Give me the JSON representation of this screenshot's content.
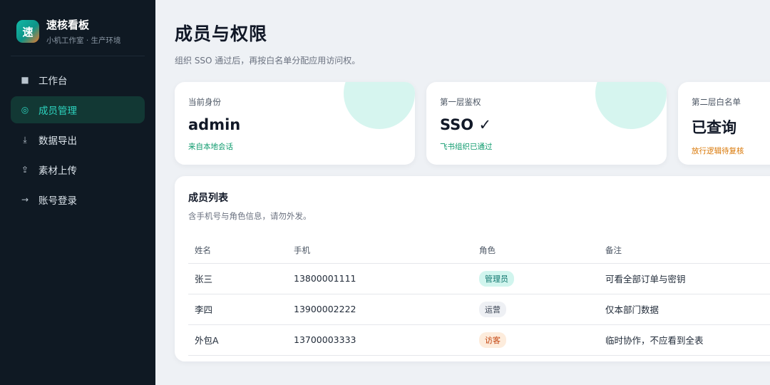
{
  "brand": {
    "logo": "速",
    "name": "速核看板",
    "subtitle": "小机工作室 · 生产环境"
  },
  "nav": [
    {
      "label": "工作台",
      "icon": "■",
      "active": false
    },
    {
      "label": "成员管理",
      "icon": "◎",
      "active": true
    },
    {
      "label": "数据导出",
      "icon": "⤓",
      "active": false
    },
    {
      "label": "素材上传",
      "icon": "⇪",
      "active": false
    },
    {
      "label": "账号登录",
      "icon": "→",
      "active": false
    }
  ],
  "page": {
    "title": "成员与权限",
    "subtitle": "组织 SSO 通过后，再按白名单分配应用访问权。"
  },
  "cards": [
    {
      "label": "当前身份",
      "value": "admin",
      "note": "来自本地会话",
      "note_color": "#0f9b6e"
    },
    {
      "label": "第一层鉴权",
      "value": "SSO ✓",
      "note": "飞书组织已通过",
      "note_color": "#0f9b6e"
    },
    {
      "label": "第二层白名单",
      "value": "已查询",
      "note": "放行逻辑待复核",
      "note_color": "#d97706"
    }
  ],
  "members": {
    "title": "成员列表",
    "subtitle": "含手机号与角色信息，请勿外发。",
    "columns": [
      "姓名",
      "手机",
      "角色",
      "备注"
    ],
    "rows": [
      {
        "name": "张三",
        "phone": "13800001111",
        "role": "管理员",
        "role_bg": "#d1f5ee",
        "role_color": "#0f766e",
        "note": "可看全部订单与密钥"
      },
      {
        "name": "李四",
        "phone": "13900002222",
        "role": "运营",
        "role_bg": "#eef0f4",
        "role_color": "#374151",
        "note": "仅本部门数据"
      },
      {
        "name": "外包A",
        "phone": "13700003333",
        "role": "访客",
        "role_bg": "#fdecdc",
        "role_color": "#c2410c",
        "note": "临时协作，不应看到全表"
      }
    ]
  }
}
